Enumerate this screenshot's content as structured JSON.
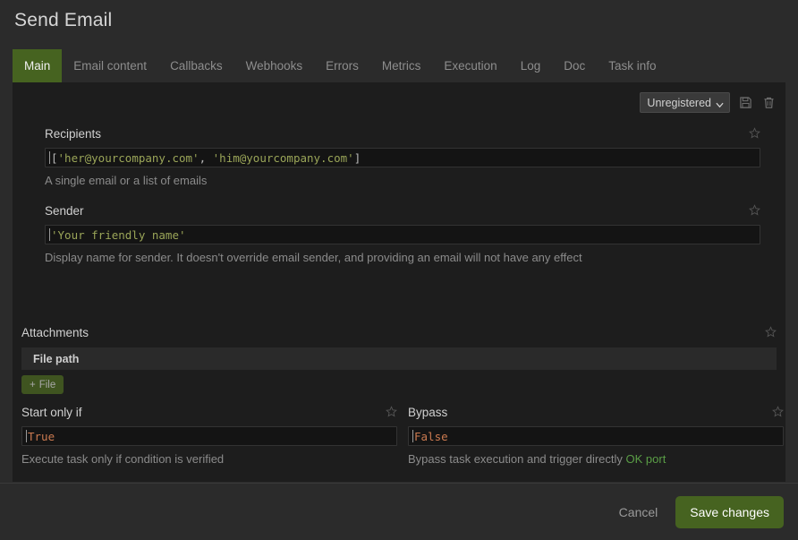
{
  "header": {
    "title": "Send Email"
  },
  "tabs": [
    {
      "label": "Main",
      "active": true
    },
    {
      "label": "Email content",
      "active": false
    },
    {
      "label": "Callbacks",
      "active": false
    },
    {
      "label": "Webhooks",
      "active": false
    },
    {
      "label": "Errors",
      "active": false
    },
    {
      "label": "Metrics",
      "active": false
    },
    {
      "label": "Execution",
      "active": false
    },
    {
      "label": "Log",
      "active": false
    },
    {
      "label": "Doc",
      "active": false
    },
    {
      "label": "Task info",
      "active": false
    }
  ],
  "toolbar": {
    "preset_selected": "Unregistered",
    "preset_options": [
      "Unregistered"
    ],
    "save_icon": "floppy-disk-icon",
    "delete_icon": "trash-icon",
    "chevron_icon": "chevron-down-icon"
  },
  "fields": {
    "recipients": {
      "label": "Recipients",
      "value": "['her@yourcompany.com', 'him@yourcompany.com']",
      "value_tokens": [
        {
          "t": "[",
          "k": "punct"
        },
        {
          "t": "'her@yourcompany.com'",
          "k": "string"
        },
        {
          "t": ", ",
          "k": "punct"
        },
        {
          "t": "'him@yourcompany.com'",
          "k": "string"
        },
        {
          "t": "]",
          "k": "punct"
        }
      ],
      "help": "A single email or a list of emails",
      "favorite_icon": "star-icon"
    },
    "sender": {
      "label": "Sender",
      "value": "'Your friendly name'",
      "value_tokens": [
        {
          "t": "'Your friendly name'",
          "k": "string"
        }
      ],
      "help": "Display name for sender. It doesn't override email sender, and providing an email will not have any effect",
      "favorite_icon": "star-icon"
    },
    "attachments": {
      "label": "Attachments",
      "column_header": "File path",
      "add_button": "File",
      "add_button_plus": "+",
      "favorite_icon": "star-icon"
    },
    "start_only_if": {
      "label": "Start only if",
      "value": "True",
      "value_tokens": [
        {
          "t": "True",
          "k": "kw"
        }
      ],
      "help": "Execute task only if condition is verified",
      "favorite_icon": "star-icon"
    },
    "bypass": {
      "label": "Bypass",
      "value": "False",
      "value_tokens": [
        {
          "t": "False",
          "k": "kw"
        }
      ],
      "help_prefix": "Bypass task execution and trigger directly ",
      "help_link": "OK port",
      "favorite_icon": "star-icon"
    }
  },
  "footer": {
    "cancel_label": "Cancel",
    "save_label": "Save changes"
  },
  "colors": {
    "accent_green": "#466320",
    "page_bg": "#2b2b2b",
    "panel_bg": "#1d1d1d",
    "input_bg": "#141414",
    "string_token": "#9aa558",
    "keyword_token": "#cb7a50",
    "port_link": "#5a9e46"
  }
}
